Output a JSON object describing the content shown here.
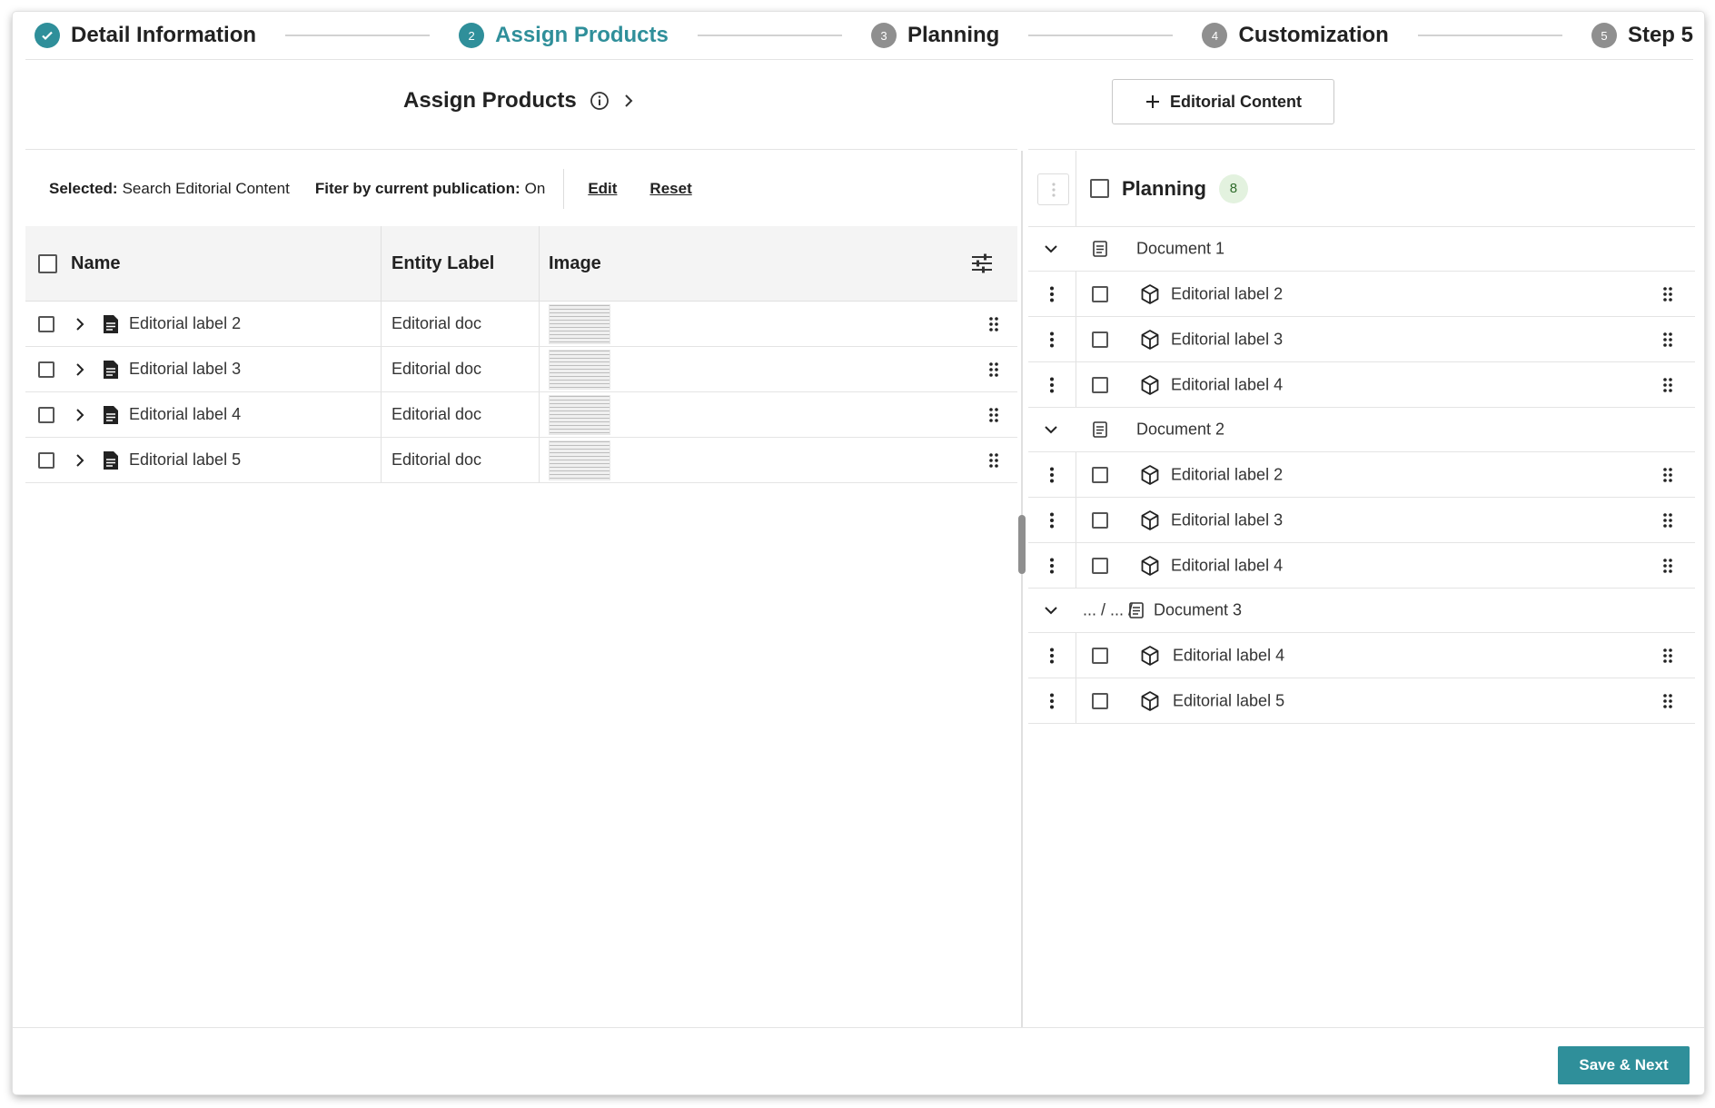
{
  "stepper": {
    "steps": [
      {
        "number": "",
        "label": "Detail Information",
        "state": "done"
      },
      {
        "number": "2",
        "label": "Assign Products",
        "state": "active"
      },
      {
        "number": "3",
        "label": "Planning",
        "state": "pending"
      },
      {
        "number": "4",
        "label": "Customization",
        "state": "pending"
      },
      {
        "number": "5",
        "label": "Step 5",
        "state": "pending"
      }
    ]
  },
  "left_header": {
    "title": "Assign Products"
  },
  "right_header": {
    "button_label": "Editorial Content"
  },
  "filter": {
    "selected_label": "Selected:",
    "selected_value": "Search Editorial Content",
    "filter_label": "Fiter by current publication:",
    "filter_value": "On",
    "edit_label": "Edit",
    "reset_label": "Reset"
  },
  "table": {
    "columns": [
      "Name",
      "Entity Label",
      "Image"
    ],
    "rows": [
      {
        "name": "Editorial label 2",
        "entity": "Editorial doc"
      },
      {
        "name": "Editorial label 3",
        "entity": "Editorial doc"
      },
      {
        "name": "Editorial label 4",
        "entity": "Editorial doc"
      },
      {
        "name": "Editorial label 5",
        "entity": "Editorial doc"
      }
    ]
  },
  "planning": {
    "title": "Planning",
    "count": "8",
    "groups": [
      {
        "name": "Document 1",
        "prefix": "",
        "items": [
          "Editorial label 2",
          "Editorial label 3",
          "Editorial label 4"
        ]
      },
      {
        "name": "Document 2",
        "prefix": "",
        "items": [
          "Editorial label 2",
          "Editorial label 3",
          "Editorial label 4"
        ]
      },
      {
        "name": "Document 3",
        "prefix": "... / ... /",
        "items": [
          "Editorial label 4",
          "Editorial label 5"
        ]
      }
    ]
  },
  "footer": {
    "save_label": "Save & Next"
  },
  "colors": {
    "accent": "#2f8f9a",
    "badge_bg": "#e3f2df",
    "badge_fg": "#2e6b2a"
  }
}
